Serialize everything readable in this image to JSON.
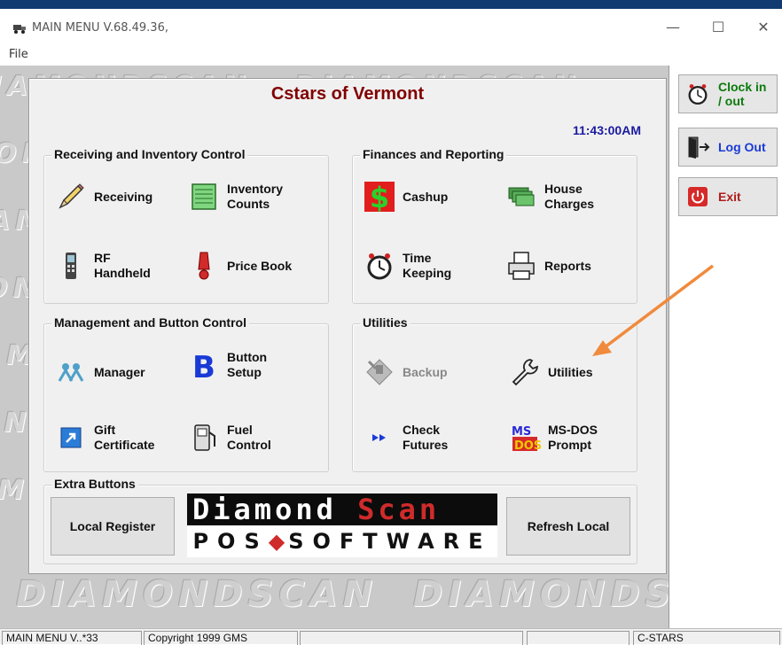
{
  "window": {
    "title": "MAIN MENU V.68.49.36,",
    "minimize": "—",
    "maximize": "☐",
    "close": "✕"
  },
  "menu": {
    "file": "File"
  },
  "header": {
    "org_name": "Cstars of Vermont",
    "clock": "11:43:00AM"
  },
  "groups": {
    "receiving": {
      "title": "Receiving and Inventory Control",
      "receiving": "Receiving",
      "inventory_counts_1": "Inventory",
      "inventory_counts_2": "Counts",
      "rf_handheld_1": "RF",
      "rf_handheld_2": "Handheld",
      "price_book": "Price Book"
    },
    "finances": {
      "title": "Finances and Reporting",
      "cashup": "Cashup",
      "house_charges_1": "House",
      "house_charges_2": "Charges",
      "time_keeping_1": "Time",
      "time_keeping_2": "Keeping",
      "reports": "Reports"
    },
    "management": {
      "title": "Management and Button Control",
      "manager": "Manager",
      "button_setup_1": "Button",
      "button_setup_2": "Setup",
      "gift_certificate_1": "Gift",
      "gift_certificate_2": "Certificate",
      "fuel_control_1": "Fuel",
      "fuel_control_2": "Control"
    },
    "utilities": {
      "title": "Utilities",
      "backup": "Backup",
      "utilities": "Utilities",
      "check_futures_1": "Check",
      "check_futures_2": "Futures",
      "msdos_1": "MS-DOS",
      "msdos_2": "Prompt"
    },
    "extra": {
      "title": "Extra Buttons",
      "local_register": "Local Register",
      "refresh_local": "Refresh Local"
    }
  },
  "logo": {
    "top_left": "Diamond",
    "top_right": "Scan",
    "bottom_left": "POS",
    "bottom_right": "SOFTWARE"
  },
  "side": {
    "clock_in_1": "Clock in",
    "clock_in_2": "/ out",
    "log_out": "Log Out",
    "exit": "Exit"
  },
  "watermark": "DIAMONDSCAN",
  "status": {
    "cell1": "MAIN MENU V..*33",
    "cell2": "Copyright 1999 GMS",
    "cell3": "",
    "cell4": "",
    "cell5": "C-STARS"
  },
  "colors": {
    "title_red": "#800000",
    "clock_blue": "#1a1aa0",
    "arrow_orange": "#f08a3c",
    "logo_red": "#cf2b2b"
  }
}
